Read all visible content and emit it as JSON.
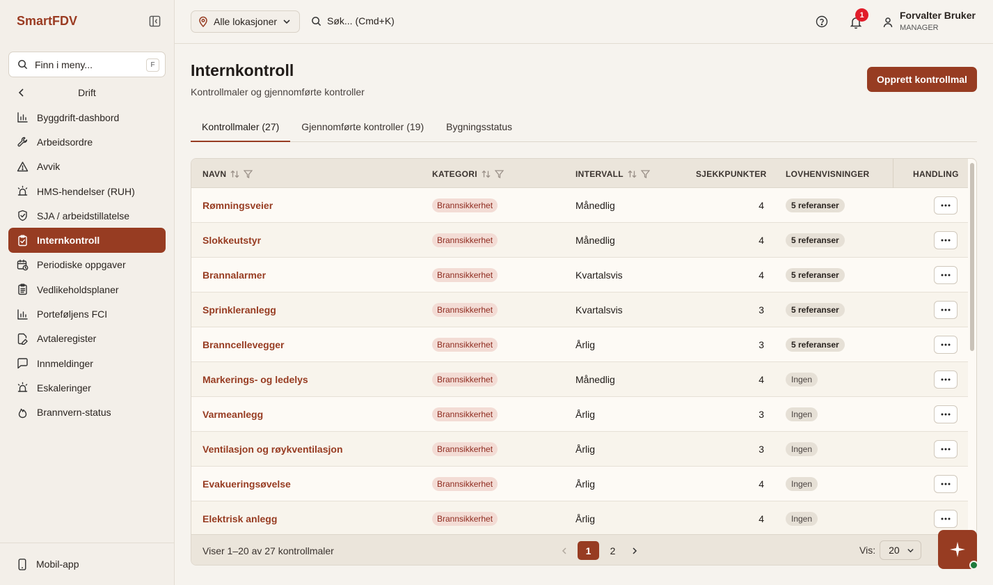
{
  "brand": "SmartFDV",
  "menu_search": {
    "placeholder": "Finn i meny...",
    "shortcut": "F"
  },
  "section": "Drift",
  "nav": [
    {
      "label": "Byggdrift-dashbord",
      "icon": "bar-chart-icon"
    },
    {
      "label": "Arbeidsordre",
      "icon": "wrench-icon"
    },
    {
      "label": "Avvik",
      "icon": "warning-icon"
    },
    {
      "label": "HMS-hendelser (RUH)",
      "icon": "siren-icon"
    },
    {
      "label": "SJA / arbeidstillatelse",
      "icon": "shield-check-icon"
    },
    {
      "label": "Internkontroll",
      "icon": "clipboard-check-icon",
      "active": true
    },
    {
      "label": "Periodiske oppgaver",
      "icon": "calendar-clock-icon"
    },
    {
      "label": "Vedlikeholdsplaner",
      "icon": "clipboard-list-icon"
    },
    {
      "label": "Porteføljens FCI",
      "icon": "bar-chart-icon"
    },
    {
      "label": "Avtaleregister",
      "icon": "file-edit-icon"
    },
    {
      "label": "Innmeldinger",
      "icon": "message-square-icon"
    },
    {
      "label": "Eskaleringer",
      "icon": "siren-icon"
    },
    {
      "label": "Brannvern-status",
      "icon": "flame-icon"
    }
  ],
  "footer_link": "Mobil-app",
  "topbar": {
    "location": "Alle lokasjoner",
    "search_placeholder": "Søk... (Cmd+K)",
    "notifications": "1",
    "user_name": "Forvalter Bruker",
    "user_role": "MANAGER"
  },
  "page": {
    "title": "Internkontroll",
    "subtitle": "Kontrollmaler og gjennomførte kontroller",
    "primary_action": "Opprett kontrollmal"
  },
  "tabs": [
    "Kontrollmaler (27)",
    "Gjennomførte kontroller (19)",
    "Bygningsstatus"
  ],
  "table": {
    "columns": [
      "NAVN",
      "KATEGORI",
      "INTERVALL",
      "SJEKKPUNKTER",
      "LOVHENVISNINGER",
      "HANDLING"
    ],
    "rows": [
      {
        "name": "Rømningsveier",
        "category": "Brannsikkerhet",
        "interval": "Månedlig",
        "checkpoints": "4",
        "laws": "5 referanser"
      },
      {
        "name": "Slokkeutstyr",
        "category": "Brannsikkerhet",
        "interval": "Månedlig",
        "checkpoints": "4",
        "laws": "5 referanser"
      },
      {
        "name": "Brannalarmer",
        "category": "Brannsikkerhet",
        "interval": "Kvartalsvis",
        "checkpoints": "4",
        "laws": "5 referanser"
      },
      {
        "name": "Sprinkleranlegg",
        "category": "Brannsikkerhet",
        "interval": "Kvartalsvis",
        "checkpoints": "3",
        "laws": "5 referanser"
      },
      {
        "name": "Branncellevegger",
        "category": "Brannsikkerhet",
        "interval": "Årlig",
        "checkpoints": "3",
        "laws": "5 referanser"
      },
      {
        "name": "Markerings- og ledelys",
        "category": "Brannsikkerhet",
        "interval": "Månedlig",
        "checkpoints": "4",
        "laws": "Ingen"
      },
      {
        "name": "Varmeanlegg",
        "category": "Brannsikkerhet",
        "interval": "Årlig",
        "checkpoints": "3",
        "laws": "Ingen"
      },
      {
        "name": "Ventilasjon og røykventilasjon",
        "category": "Brannsikkerhet",
        "interval": "Årlig",
        "checkpoints": "3",
        "laws": "Ingen"
      },
      {
        "name": "Evakueringsøvelse",
        "category": "Brannsikkerhet",
        "interval": "Årlig",
        "checkpoints": "4",
        "laws": "Ingen"
      },
      {
        "name": "Elektrisk anlegg",
        "category": "Brannsikkerhet",
        "interval": "Årlig",
        "checkpoints": "4",
        "laws": "Ingen"
      }
    ]
  },
  "footer": {
    "summary": "Viser 1–20 av 27 kontrollmaler",
    "pages": [
      "1",
      "2"
    ],
    "current_page": "1",
    "per_page_label": "Vis:",
    "per_page": "20"
  },
  "colors": {
    "accent": "#973c22",
    "badge": "#e11d2a",
    "online": "#1e7a3c"
  }
}
